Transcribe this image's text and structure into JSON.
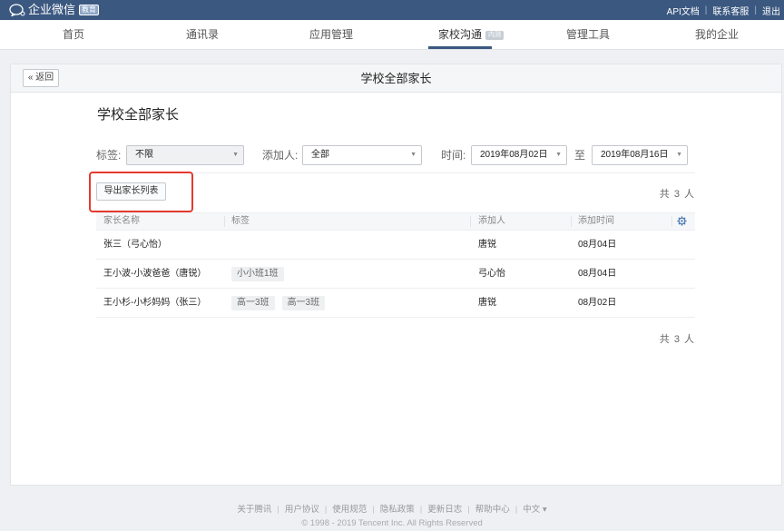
{
  "topbar": {
    "brand": "企业微信",
    "edition_badge": "教育",
    "links": [
      "API文档",
      "联系客服",
      "退出"
    ]
  },
  "nav": {
    "items": [
      {
        "label": "首页"
      },
      {
        "label": "通讯录"
      },
      {
        "label": "应用管理"
      },
      {
        "label": "家校沟通",
        "badge": "内测",
        "active": true
      },
      {
        "label": "管理工具"
      },
      {
        "label": "我的企业"
      }
    ]
  },
  "card": {
    "back_label": "返回",
    "title": "学校全部家长"
  },
  "page": {
    "heading": "学校全部家长",
    "filters": {
      "tag_label": "标签:",
      "tag_value": "不限",
      "adder_label": "添加人:",
      "adder_value": "全部",
      "time_label": "时间:",
      "date_from": "2019年08月02日",
      "to_label": "至",
      "date_to": "2019年08月16日"
    },
    "export_label": "导出家长列表",
    "total_text": "共 3 人"
  },
  "table": {
    "headers": [
      "家长名称",
      "标签",
      "添加人",
      "添加时间"
    ],
    "rows": [
      {
        "name": "张三（弓心怡）",
        "tags": [],
        "adder": "唐锐",
        "time": "08月04日"
      },
      {
        "name": "王小波-小波爸爸（唐锐）",
        "tags": [
          "小小班1班"
        ],
        "adder": "弓心怡",
        "time": "08月04日"
      },
      {
        "name": "王小杉-小杉妈妈（张三）",
        "tags": [
          "高一3班",
          "高一3班"
        ],
        "adder": "唐锐",
        "time": "08月02日"
      }
    ]
  },
  "footer": {
    "links": [
      "关于腾讯",
      "用户协议",
      "使用规范",
      "隐私政策",
      "更新日志",
      "帮助中心",
      "中文 ▾"
    ],
    "copyright": "© 1998 - 2019 Tencent Inc. All Rights Reserved"
  },
  "colors": {
    "topbar": "#3b5880",
    "highlight": "#e53a2f"
  }
}
